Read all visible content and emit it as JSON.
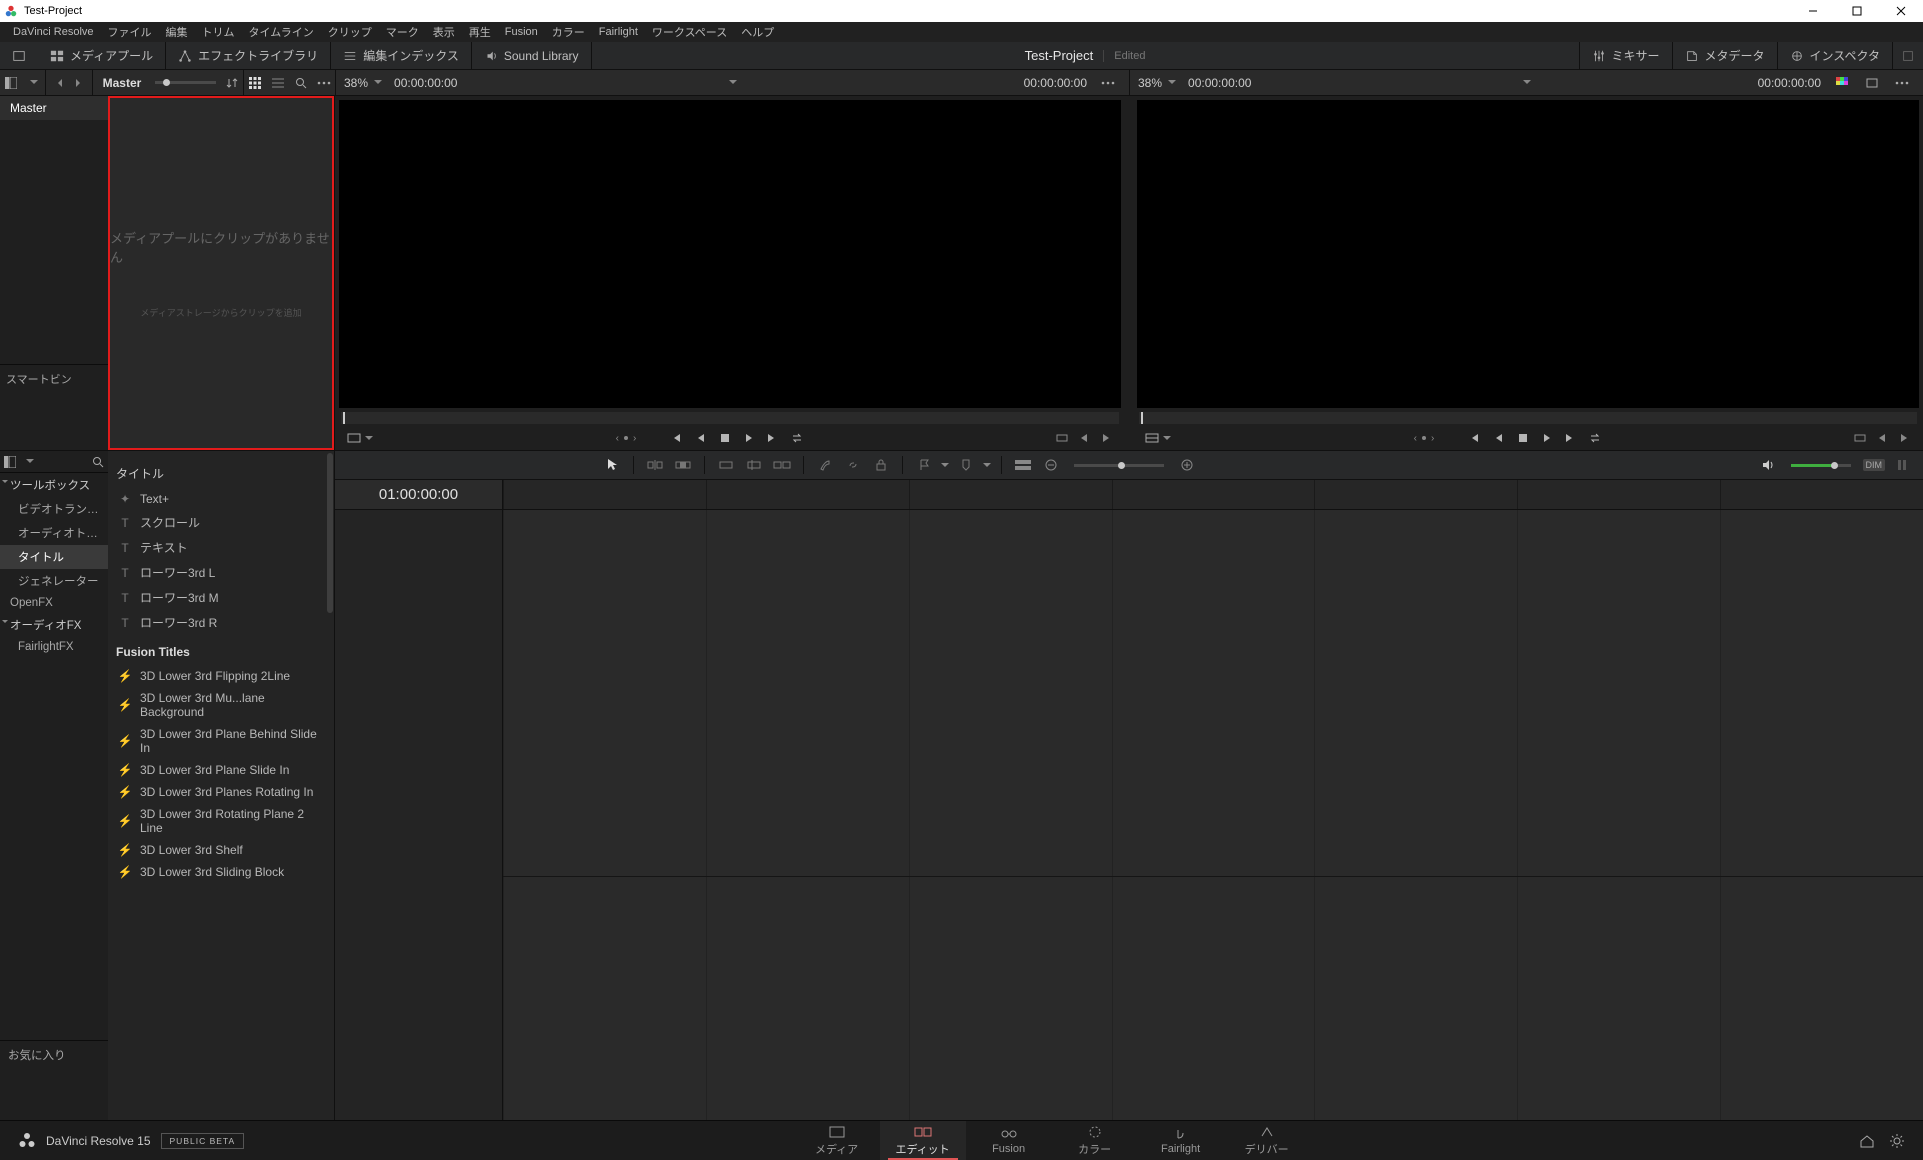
{
  "window": {
    "title": "Test-Project"
  },
  "menubar": [
    "DaVinci Resolve",
    "ファイル",
    "編集",
    "トリム",
    "タイムライン",
    "クリップ",
    "マーク",
    "表示",
    "再生",
    "Fusion",
    "カラー",
    "Fairlight",
    "ワークスペース",
    "ヘルプ"
  ],
  "toolbar": {
    "media_pool": "メディアプール",
    "effects_lib": "エフェクトライブラリ",
    "edit_index": "編集インデックス",
    "sound_lib": "Sound Library",
    "project_name": "Test-Project",
    "project_status": "Edited",
    "mixer": "ミキサー",
    "metadata": "メタデータ",
    "inspector": "インスペクタ"
  },
  "pool_strip": {
    "breadcrumb": "Master"
  },
  "viewer_strip": {
    "src": {
      "zoom": "38%",
      "tc_left": "00:00:00:00",
      "tc_right": "00:00:00:00"
    },
    "rec": {
      "zoom": "38%",
      "tc_left": "00:00:00:00",
      "tc_right": "00:00:00:00"
    }
  },
  "bins": {
    "master": "Master",
    "smart": "スマートビン"
  },
  "pool_empty": {
    "line1": "メディアプールにクリップがありません",
    "line2": "メディアストレージからクリップを追加"
  },
  "fx": {
    "cats": {
      "toolbox": "ツールボックス",
      "video_trans": "ビデオトランジション",
      "audio_trans": "オーディオトランジ...",
      "title": "タイトル",
      "generator": "ジェネレーター",
      "openfx": "OpenFX",
      "audiofx": "オーディオFX",
      "fairlightfx": "FairlightFX",
      "fav": "お気に入り"
    },
    "group_title": "タイトル",
    "titles": [
      "Text+",
      "スクロール",
      "テキスト",
      "ローワー3rd L",
      "ローワー3rd M",
      "ローワー3rd R"
    ],
    "fusion_group": "Fusion Titles",
    "fusion_titles": [
      "3D Lower 3rd Flipping 2Line",
      "3D Lower 3rd Mu...lane Background",
      "3D Lower 3rd Plane Behind Slide In",
      "3D Lower 3rd Plane Slide In",
      "3D Lower 3rd Planes Rotating In",
      "3D Lower 3rd Rotating Plane 2 Line",
      "3D Lower 3rd Shelf",
      "3D Lower 3rd Sliding Block"
    ]
  },
  "mid": {
    "dim": "DIM"
  },
  "timeline": {
    "tc": "01:00:00:00"
  },
  "pages": {
    "brand": "DaVinci Resolve 15",
    "beta": "PUBLIC BETA",
    "tabs": [
      "メディア",
      "エディット",
      "Fusion",
      "カラー",
      "Fairlight",
      "デリバー"
    ]
  }
}
